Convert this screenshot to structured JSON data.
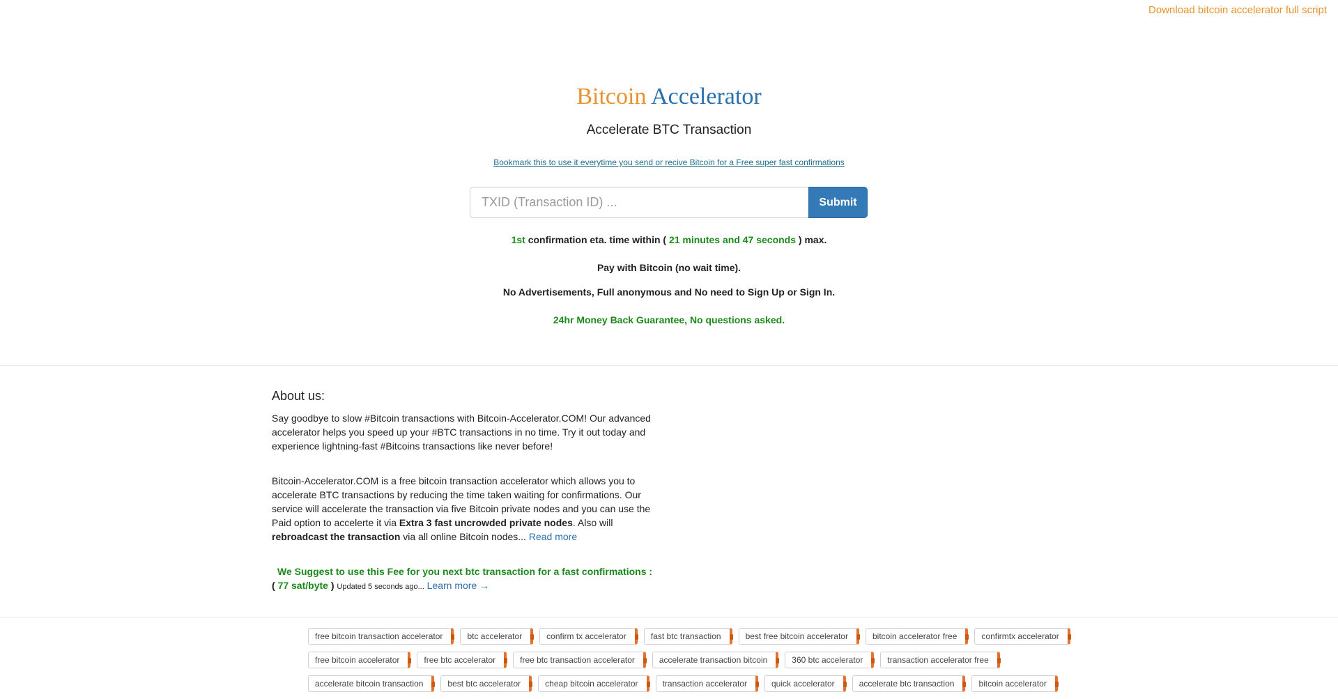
{
  "topbar": {
    "download_link": "Download bitcoin accelerator full script"
  },
  "hero": {
    "title_part1": "Bitcoin",
    "title_part2": "Accelerator",
    "subtitle": "Accelerate BTC Transaction ",
    "bookmark_link": " Bookmark this to use it everytime you send or recive Bitcoin for a Free super fast confirmations "
  },
  "search": {
    "placeholder": "TXID (Transaction ID) ...",
    "submit_label": "Submit"
  },
  "info": {
    "eta_prefix": "1st",
    "eta_text": " confirmation eta. time within ( ",
    "eta_time": "21 minutes and 47 seconds",
    "eta_suffix": " ) max.",
    "pay_line": "Pay with Bitcoin (no wait time).",
    "features_line": "No Advertisements, Full anonymous and No need to Sign Up or Sign In.",
    "guarantee_line": "24hr Money Back Guarantee, No questions asked."
  },
  "about": {
    "heading_icon": "",
    "heading_text": " About ",
    "heading_bold": "us:",
    "para1": "Say goodbye to slow #Bitcoin transactions with Bitcoin-Accelerator.COM! Our advanced accelerator helps you speed up your #BTC transactions in no time. Try it out today and experience lightning-fast #Bitcoins transactions like never before!",
    "para2_a": "Bitcoin-Accelerator.COM is a free bitcoin transaction accelerator which allows you to accelerate BTC transactions by reducing the time taken waiting for confirmations. Our service will accelerate the transaction via five Bitcoin private nodes and you can use the Paid option to accelerte it via ",
    "para2_b": "Extra 3 fast uncrowded private nodes",
    "para2_c": ". Also will ",
    "para2_d": "rebroadcast the transaction",
    "para2_e": " via all online Bitcoin nodes... ",
    "read_more": "Read more",
    "fee_heading": "We Suggest to use this Fee for you next btc transaction for a fast confirmations :",
    "fee_open": "( ",
    "fee_value": "77 sat/byte",
    "fee_close": " )",
    "fee_updated": "Updated 5 seconds ago...",
    "learn_more": "Learn more →"
  },
  "tags": {
    "row1": [
      "free bitcoin transaction accelerator",
      "btc accelerator",
      "confirm tx accelerator",
      "fast btc transaction",
      "best free bitcoin accelerator",
      "bitcoin accelerator free",
      "confirmtx accelerator"
    ],
    "row2": [
      "free bitcoin accelerator",
      "free btc accelerator",
      "free btc transaction accelerator",
      "accelerate transaction bitcoin",
      "360 btc accelerator",
      "transaction accelerator free"
    ],
    "row3": [
      "accelerate bitcoin transaction",
      "best btc accelerator",
      "cheap bitcoin accelerator",
      "transaction accelerator",
      "quick accelerator",
      "accelerate btc transaction",
      "bitcoin accelerator"
    ]
  }
}
